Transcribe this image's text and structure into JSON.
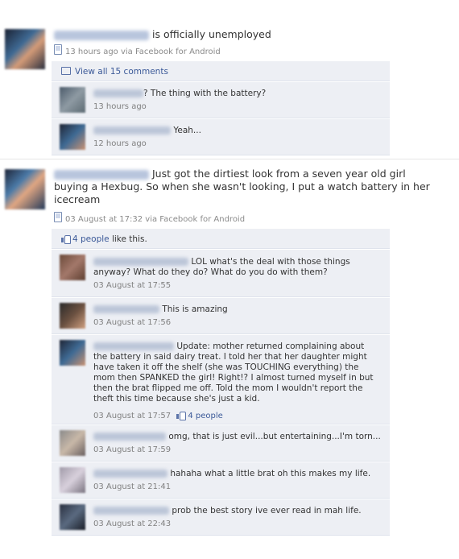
{
  "post1": {
    "status": "is officially unemployed",
    "meta": "13 hours ago via Facebook for Android",
    "view_all": "View all 15 comments",
    "comments": [
      {
        "text": "? The thing with the battery?",
        "time": "13 hours ago"
      },
      {
        "text": "Yeah...",
        "time": "12 hours ago"
      }
    ]
  },
  "post2": {
    "status_line1": "Just got the dirtiest look from a seven year old girl",
    "status_line2": "buying a Hexbug. So when she wasn't looking, I put a watch battery in her",
    "status_line3": "icecream",
    "meta": "03 August at 17:32 via Facebook for Android",
    "likes": "4 people",
    "likes_suffix": " like this.",
    "comments": [
      {
        "line1": "LOL what's the deal with those things",
        "line2": "anyway? What do they do? What do you do with them?",
        "time": "03 August at 17:55"
      },
      {
        "line1": "This is amazing",
        "time": "03 August at 17:56"
      },
      {
        "line1": "Update: mother returned complaining about",
        "line2": "the battery in said dairy treat. I told her that her daughter might",
        "line3": "have taken it off the shelf (she was TOUCHING everything) the",
        "line4": "mom then SPANKED the girl! Right!? I almost turned myself in but",
        "line5": "then the brat flipped me off. Told the mom I wouldn't report the",
        "line6": "theft this time because she's just a kid.",
        "time": "03 August at 17:57",
        "likes": "4 people"
      },
      {
        "line1": "omg, that is just evil...but entertaining...I'm torn...",
        "time": "03 August at 17:59"
      },
      {
        "line1": "hahaha what a little brat oh this makes my life.",
        "time": "03 August at 21:41"
      },
      {
        "line1": "prob the best story ive ever read in mah life.",
        "time": "03 August at 22:43"
      }
    ]
  }
}
